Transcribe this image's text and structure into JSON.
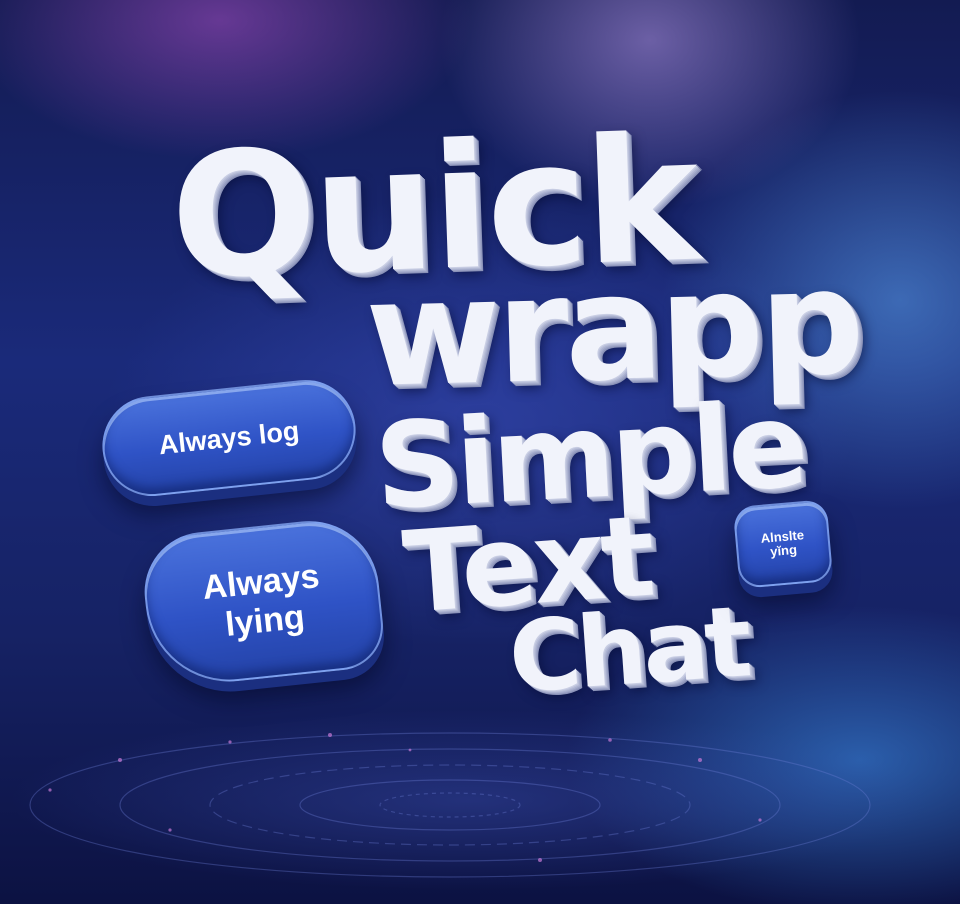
{
  "title_words": [
    "Quick",
    "wrapp",
    "Simple",
    "Text",
    "Chat"
  ],
  "bubbles": [
    {
      "text": "Always log"
    },
    {
      "text": "Always\nlying"
    },
    {
      "text": "Alnslte\nyĭng"
    }
  ],
  "colors": {
    "background_dark": "#131b52",
    "background_mid": "#1a2a7a",
    "bubble_blue": "#2f53c6",
    "letter_white": "#f1f3fb"
  }
}
